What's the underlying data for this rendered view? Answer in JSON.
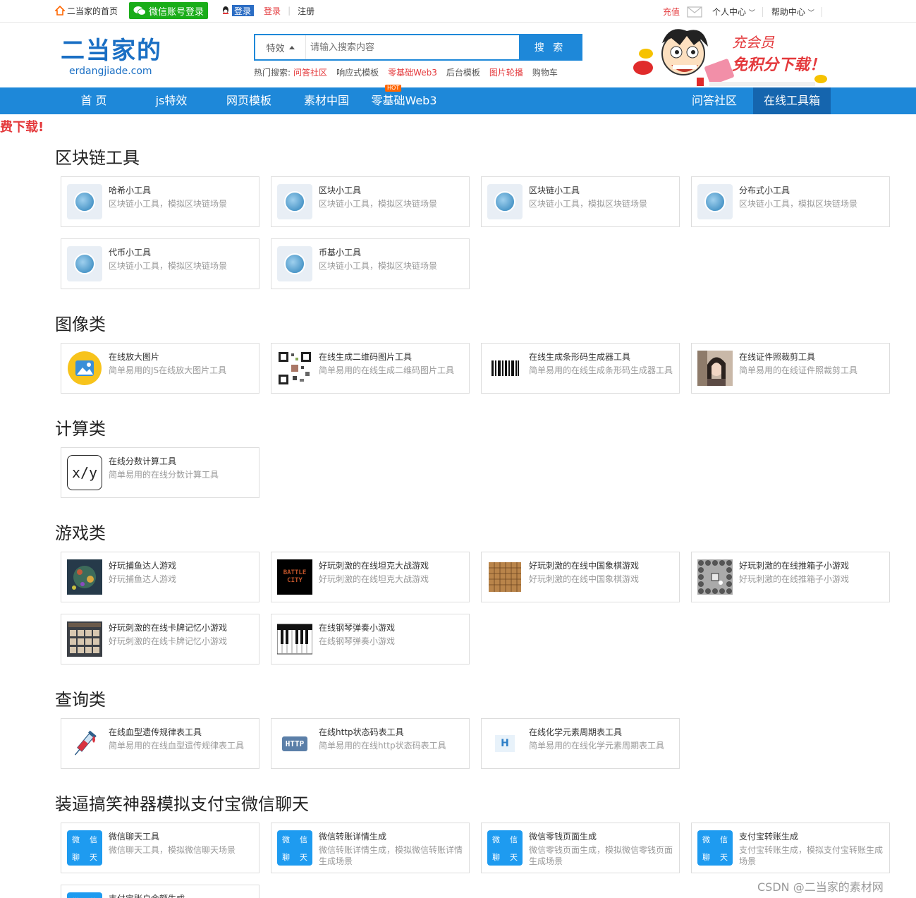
{
  "topbar": {
    "home": "二当家的首页",
    "wechat_login": "微信账号登录",
    "qq_login": "登录",
    "login": "登录",
    "register": "注册",
    "recharge": "充值",
    "user_center": "个人中心",
    "help_center": "帮助中心"
  },
  "header": {
    "logo_cn": "二当家的",
    "logo_en": "erdangjiade.com",
    "search_type": "特效",
    "search_placeholder": "请输入搜索内容",
    "search_button": "搜 索",
    "hot_label": "热门搜索:",
    "hot_items": [
      {
        "text": "问答社区",
        "color": "red"
      },
      {
        "text": "响应式模板",
        "color": "gray"
      },
      {
        "text": "零基础Web3",
        "color": "red"
      },
      {
        "text": "后台模板",
        "color": "gray"
      },
      {
        "text": "图片轮播",
        "color": "red"
      },
      {
        "text": "购物车",
        "color": "gray"
      }
    ],
    "promo_line1": "充会员",
    "promo_line2": "免积分下载！",
    "promo_tag": "充值"
  },
  "nav": {
    "items": [
      "首 页",
      "js特效",
      "网页模板",
      "素材中国",
      "零基础Web3",
      "问答社区",
      "在线工具箱"
    ],
    "hot_badge": "HOT"
  },
  "marquee": "费下载!",
  "sections": [
    {
      "title": "区块链工具",
      "cards": [
        {
          "title": "哈希小工具",
          "desc": "区块链小工具，模拟区块链场景",
          "thumb": "chain"
        },
        {
          "title": "区块小工具",
          "desc": "区块链小工具，模拟区块链场景",
          "thumb": "chain"
        },
        {
          "title": "区块链小工具",
          "desc": "区块链小工具，模拟区块链场景",
          "thumb": "chain"
        },
        {
          "title": "分布式小工具",
          "desc": "区块链小工具，模拟区块链场景",
          "thumb": "chain"
        },
        {
          "title": "代币小工具",
          "desc": "区块链小工具，模拟区块链场景",
          "thumb": "chain"
        },
        {
          "title": "币基小工具",
          "desc": "区块链小工具，模拟区块链场景",
          "thumb": "chain"
        }
      ]
    },
    {
      "title": "图像类",
      "cards": [
        {
          "title": "在线放大图片",
          "desc": "简单易用的JS在线放大图片工具",
          "thumb": "image"
        },
        {
          "title": "在线生成二维码图片工具",
          "desc": "简单易用的在线生成二维码图片工具",
          "thumb": "qr"
        },
        {
          "title": "在线生成条形码生成器工具",
          "desc": "简单易用的在线生成条形码生成器工具",
          "thumb": "barcode"
        },
        {
          "title": "在线证件照裁剪工具",
          "desc": "简单易用的在线证件照裁剪工具",
          "thumb": "photo"
        }
      ]
    },
    {
      "title": "计算类",
      "cards": [
        {
          "title": "在线分数计算工具",
          "desc": "简单易用的在线分数计算工具",
          "thumb": "fraction",
          "thumb_text": "x/y"
        }
      ]
    },
    {
      "title": "游戏类",
      "cards": [
        {
          "title": "好玩捕鱼达人游戏",
          "desc": "好玩捕鱼达人游戏",
          "thumb": "fish"
        },
        {
          "title": "好玩刺激的在线坦克大战游戏",
          "desc": "好玩刺激的在线坦克大战游戏",
          "thumb": "tank",
          "thumb_text": "BATTLE CITY"
        },
        {
          "title": "好玩刺激的在线中国象棋游戏",
          "desc": "好玩刺激的在线中国象棋游戏",
          "thumb": "chess"
        },
        {
          "title": "好玩刺激的在线推箱子小游戏",
          "desc": "好玩刺激的在线推箱子小游戏",
          "thumb": "sokoban"
        },
        {
          "title": "好玩刺激的在线卡牌记忆小游戏",
          "desc": "好玩刺激的在线卡牌记忆小游戏",
          "thumb": "cards"
        },
        {
          "title": "在线钢琴弹奏小游戏",
          "desc": "在线钢琴弹奏小游戏",
          "thumb": "piano"
        }
      ]
    },
    {
      "title": "查询类",
      "cards": [
        {
          "title": "在线血型遗传规律表工具",
          "desc": "简单易用的在线血型遗传规律表工具",
          "thumb": "blood"
        },
        {
          "title": "在线http状态码表工具",
          "desc": "简单易用的在线http状态码表工具",
          "thumb": "http",
          "thumb_text": "HTTP"
        },
        {
          "title": "在线化学元素周期表工具",
          "desc": "简单易用的在线化学元素周期表工具",
          "thumb": "element",
          "thumb_text": "H"
        }
      ]
    },
    {
      "title": "装逼搞笑神器模拟支付宝微信聊天",
      "cards": [
        {
          "title": "微信聊天工具",
          "desc": "微信聊天工具，模拟微信聊天场景",
          "thumb": "wx",
          "thumb_text": [
            "微",
            "信",
            "聊",
            "天"
          ]
        },
        {
          "title": "微信转账详情生成",
          "desc": "微信转账详情生成，模拟微信转账详情生成场景",
          "thumb": "wx",
          "thumb_text": [
            "微",
            "信",
            "聊",
            "天"
          ]
        },
        {
          "title": "微信零钱页面生成",
          "desc": "微信零钱页面生成，模拟微信零钱页面生成场景",
          "thumb": "wx",
          "thumb_text": [
            "微",
            "信",
            "聊",
            "天"
          ]
        },
        {
          "title": "支付宝转账生成",
          "desc": "支付宝转账生成，模拟支付宝转账生成场景",
          "thumb": "wx",
          "thumb_text": [
            "微",
            "信",
            "聊",
            "天"
          ]
        },
        {
          "title": "支付宝账户余额生成",
          "desc": "",
          "thumb": "wx",
          "thumb_text": [
            "微",
            "信",
            "聊",
            "天"
          ]
        }
      ]
    }
  ],
  "watermark": "CSDN @二当家的素材网"
}
